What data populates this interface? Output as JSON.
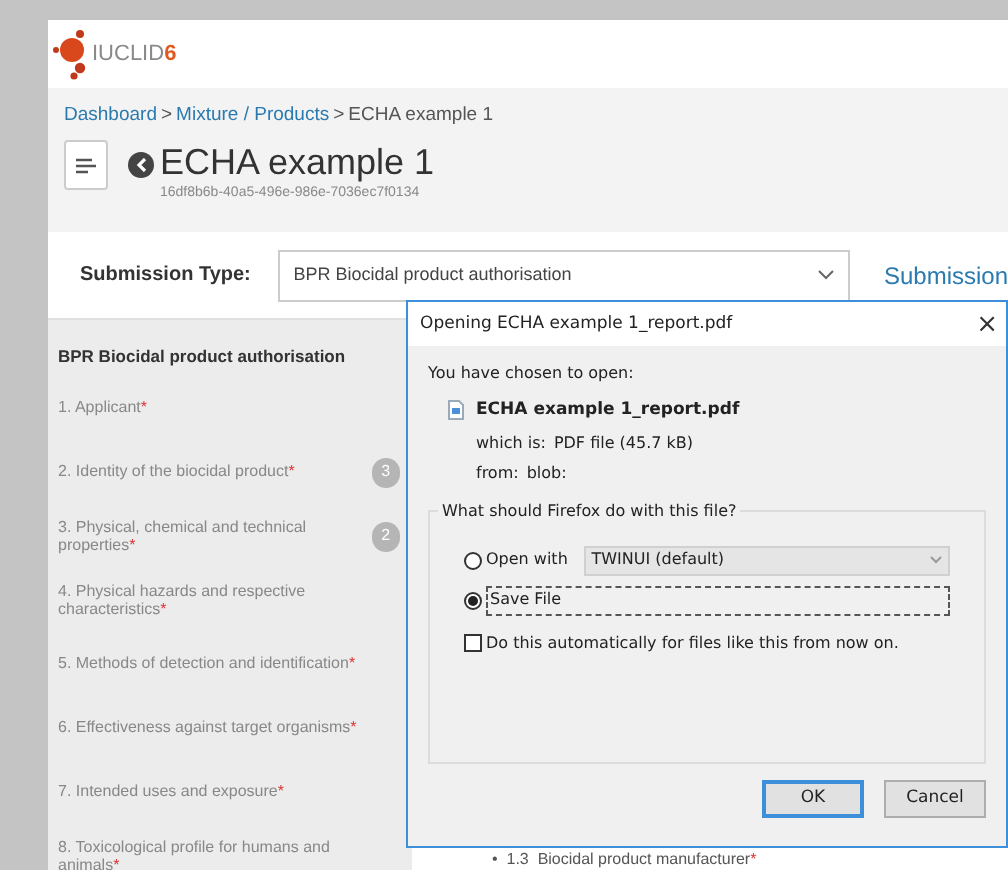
{
  "app": {
    "logo_text": "IUCLID",
    "logo_version": "6"
  },
  "breadcrumb": [
    {
      "label": "Dashboard",
      "link": true
    },
    {
      "separator": ">",
      "label": "Mixture / Products",
      "link": true
    },
    {
      "separator": ">",
      "label": "ECHA example 1",
      "link": false
    }
  ],
  "dataset": {
    "title": "ECHA example 1",
    "id": "16df8b6b-40a5-496e-986e-7036ec7f0134"
  },
  "submission": {
    "label": "Submission Type:",
    "value": "BPR Biocidal product authorisation",
    "link": "Submission"
  },
  "sidebar": {
    "heading": "BPR Biocidal product authorisation",
    "items": [
      {
        "label": "1. Applicant",
        "marker": "*"
      },
      {
        "label": "2. Identity of the biocidal product",
        "marker": "*",
        "badge": "3"
      },
      {
        "label": "3. Physical, chemical and technical properties",
        "marker": "*",
        "badge": "2"
      },
      {
        "label": "4. Physical hazards and respective characteristics",
        "marker": "*"
      },
      {
        "label": "5. Methods of detection and identification",
        "marker": "*"
      },
      {
        "label": "6. Effectiveness against target organisms",
        "marker": "*"
      },
      {
        "label": "7. Intended uses and exposure",
        "marker": "*"
      },
      {
        "label": "8. Toxicological profile for humans and animals",
        "marker": "*"
      }
    ]
  },
  "content_items": [
    {
      "bullet": "•",
      "label": "1.3  Biocidal product manufacturer",
      "marker": "*"
    }
  ],
  "dialog": {
    "title": "Opening ECHA example 1_report.pdf",
    "close": "×",
    "intro": "You have chosen to open:",
    "file_name": "ECHA example 1_report.pdf",
    "details": [
      {
        "label": "which is:",
        "value": "PDF file (45.7 kB)"
      },
      {
        "label": "from:",
        "value": "blob:"
      }
    ],
    "group_label": "What should Firefox do with this file?",
    "options": [
      {
        "kind": "open_with",
        "label": "Open with",
        "app": "TWINUI (default)",
        "selected": false
      },
      {
        "kind": "save",
        "label": "Save File",
        "selected": true
      }
    ],
    "auto": {
      "label": "Do this automatically for files like this from now on.",
      "checked": false
    },
    "buttons": [
      {
        "label": "OK",
        "default": true
      },
      {
        "label": "Cancel",
        "default": false
      }
    ]
  }
}
